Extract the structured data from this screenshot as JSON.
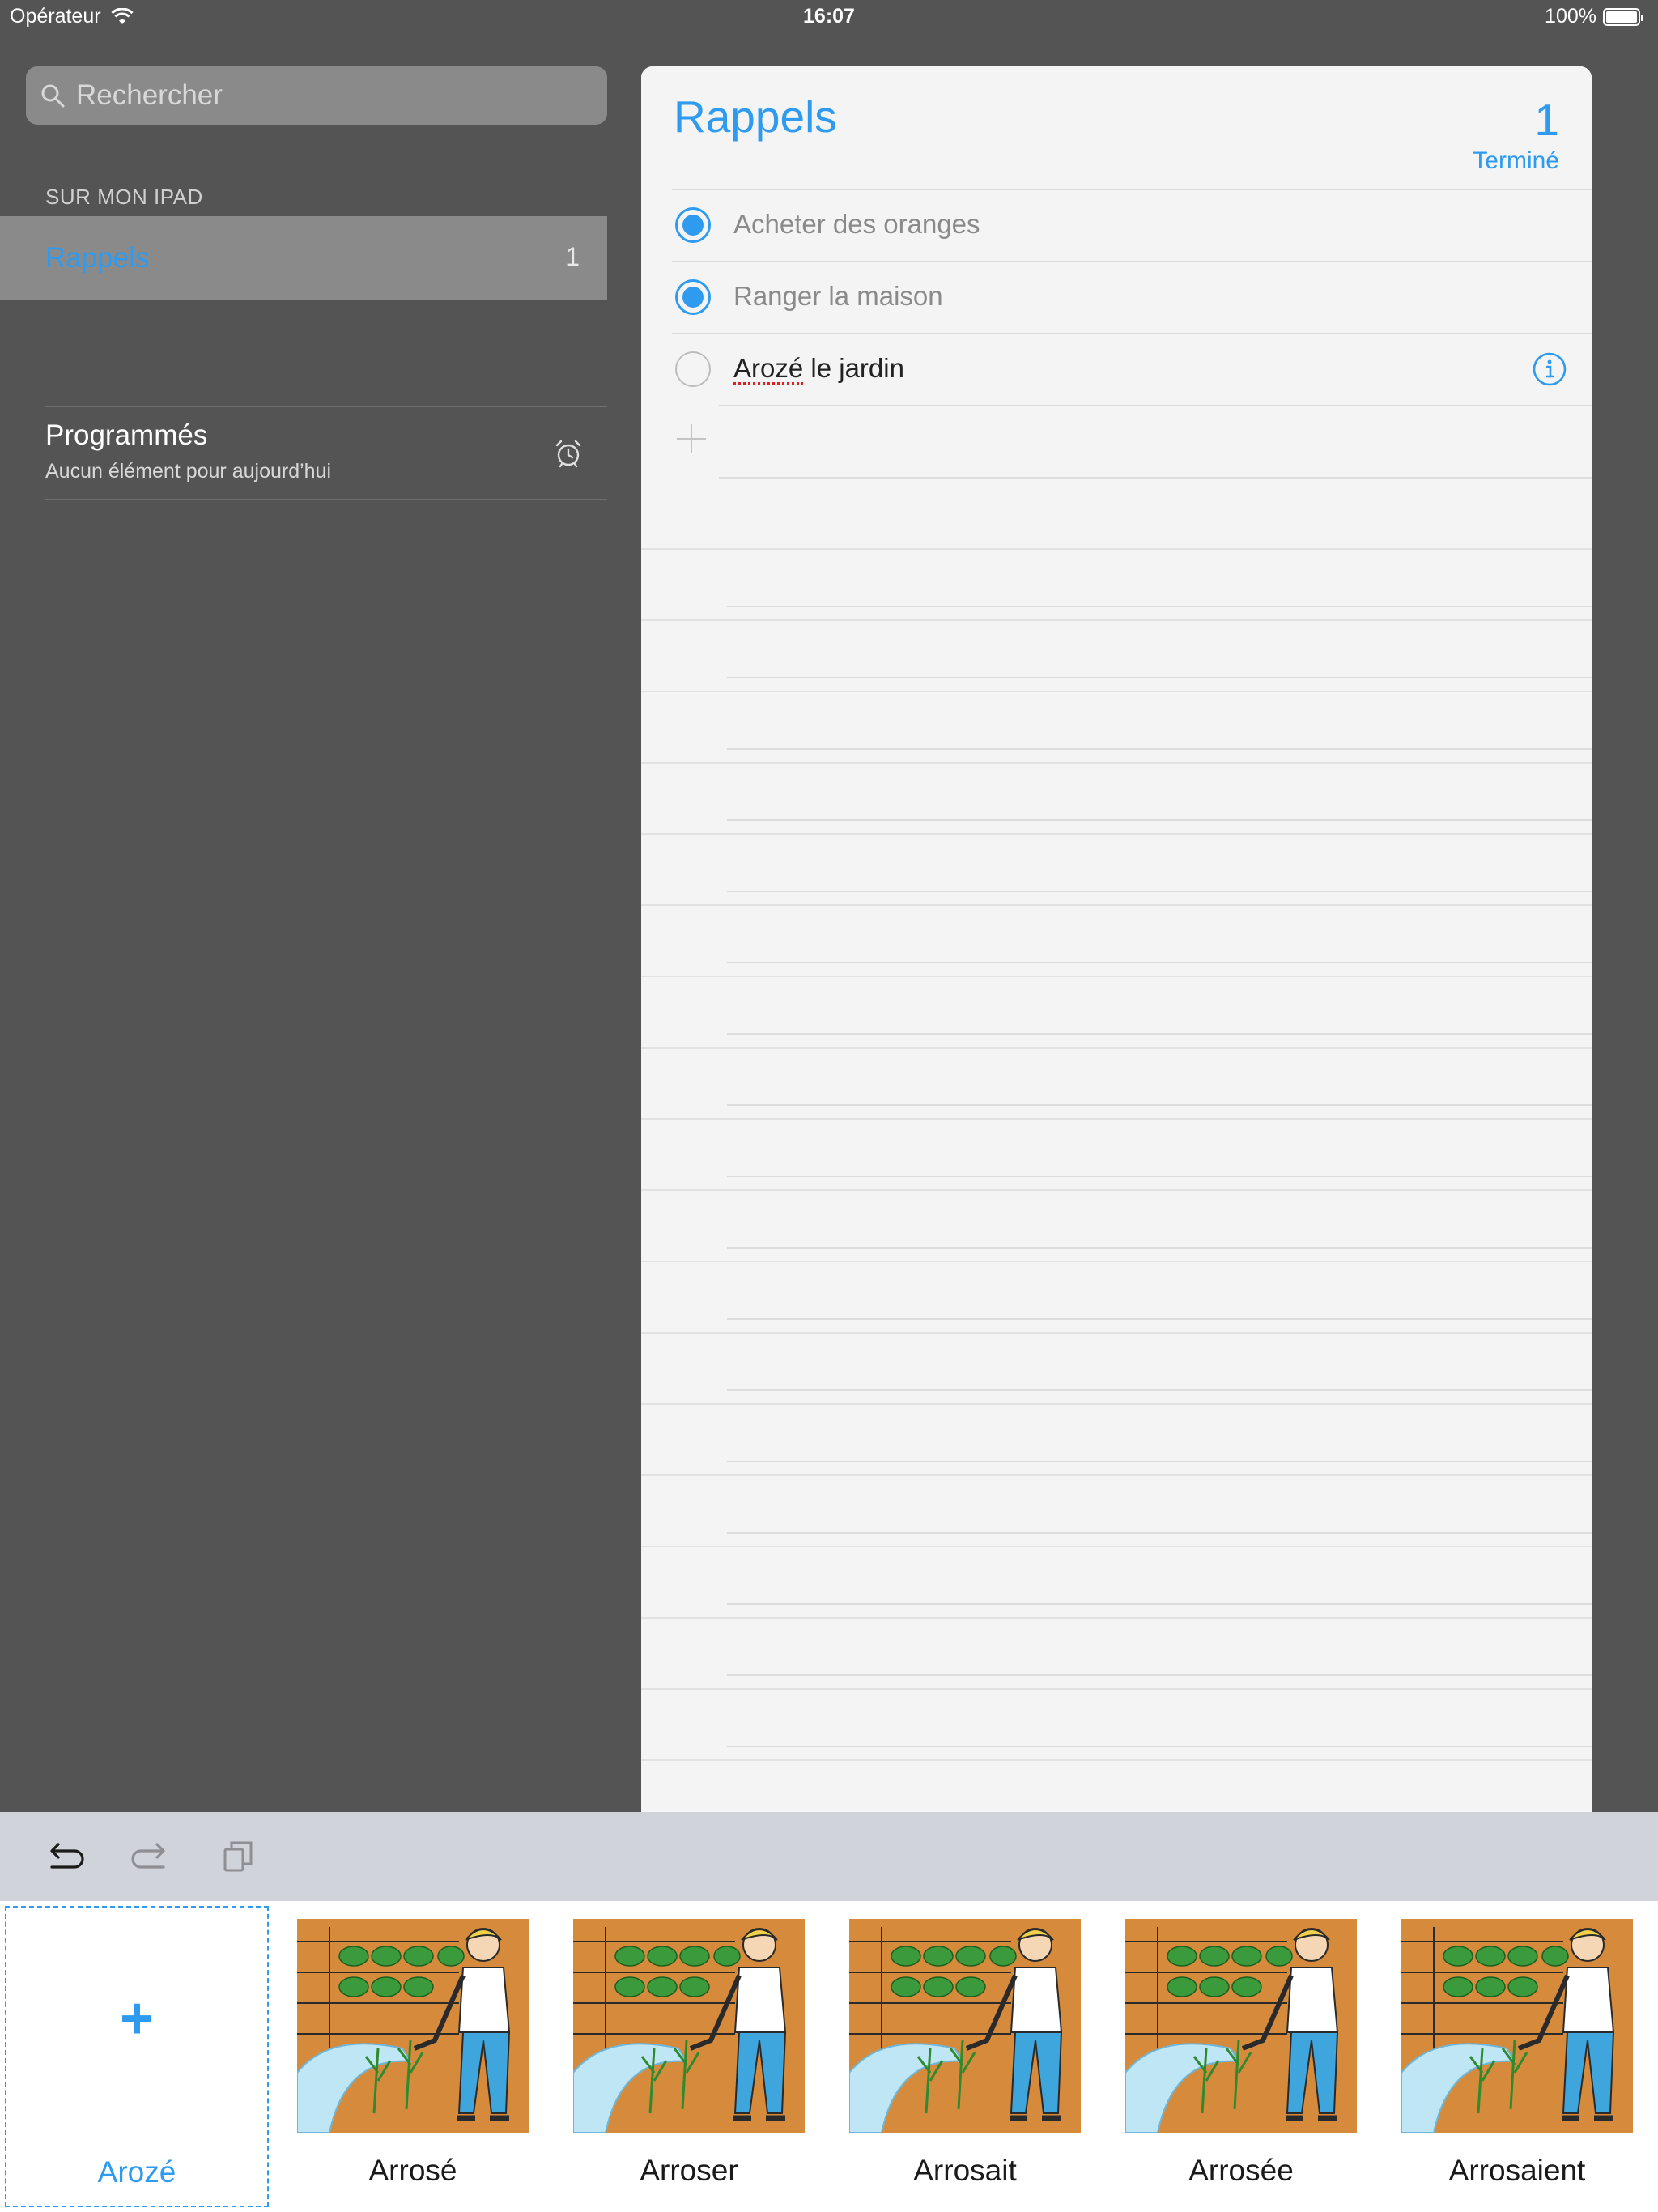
{
  "status_bar": {
    "carrier": "Opérateur",
    "time": "16:07",
    "battery": "100%"
  },
  "sidebar": {
    "search_placeholder": "Rechercher",
    "section_label": "SUR MON IPAD",
    "lists": [
      {
        "name": "Rappels",
        "count": "1"
      }
    ],
    "scheduled": {
      "title": "Programmés",
      "subtitle": "Aucun élément pour aujourd’hui"
    }
  },
  "main": {
    "title": "Rappels",
    "done_count": "1",
    "done_button": "Terminé",
    "tasks": [
      {
        "text": "Acheter des oranges",
        "completed": true
      },
      {
        "text": "Ranger la maison",
        "completed": true
      },
      {
        "text_misspelled": "Arozé",
        "text_rest": " le jardin",
        "completed": false
      }
    ]
  },
  "keyboard": {
    "predictions": [
      "Arozé",
      "Arrosé",
      "Arroser",
      "Arrosait",
      "Arrosée",
      "Arrosaient"
    ]
  },
  "colors": {
    "accent": "#2e9bf0",
    "sidebar_bg": "#545454",
    "selected_bg": "#8a8a8a",
    "paper": "#f4f4f4"
  }
}
